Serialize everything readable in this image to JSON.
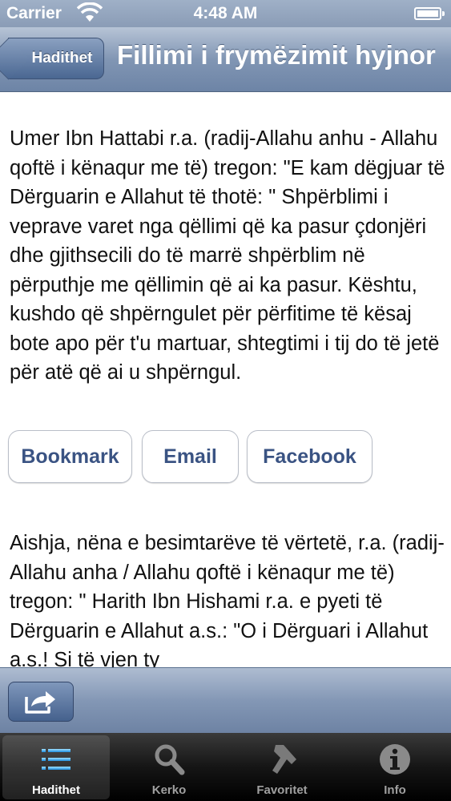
{
  "status_bar": {
    "carrier": "Carrier",
    "time": "4:48 AM"
  },
  "nav_bar": {
    "back_label": "Hadithet",
    "title": "Fillimi i frymëzimit hyjnor"
  },
  "content": {
    "paragraph_1": "Umer Ibn Hattabi r.a. (radij-Allahu anhu - Allahu qoftë i kënaqur me të) tregon: \"E kam dëgjuar të Dërguarin e Allahut të thotë: \" Shpërblimi i veprave varet nga qëllimi që ka pasur çdonjëri dhe gjithsecili do të marrë shpërblim në përputhje me qëllimin që ai ka pasur. Kështu, kushdo që shpërngulet për përfitime të kësaj bote apo për t'u martuar, shtegtimi i tij do të jetë për atë që ai u shpërngul.",
    "actions": {
      "bookmark": "Bookmark",
      "email": "Email",
      "facebook": "Facebook"
    },
    "paragraph_2": "Aishja, nëna e besimtarëve të vërtetë, r.a. (radij-Allahu anha / Allahu qoftë i kënaqur me të) tregon: \" Harith Ibn Hishami r.a. e pyeti të Dërguarin e Allahut a.s.: \"O i Dërguari i Allahut a.s.! Si të vjen ty"
  },
  "tab_bar": {
    "tabs": [
      {
        "label": "Hadithet",
        "icon": "list-icon",
        "selected": true
      },
      {
        "label": "Kerko",
        "icon": "search-icon",
        "selected": false
      },
      {
        "label": "Favoritet",
        "icon": "bookmark-icon",
        "selected": false
      },
      {
        "label": "Info",
        "icon": "info-icon",
        "selected": false
      }
    ]
  },
  "colors": {
    "accent": "#3a5383",
    "nav_bar": "#8196b4",
    "tab_bar": "#151515"
  }
}
